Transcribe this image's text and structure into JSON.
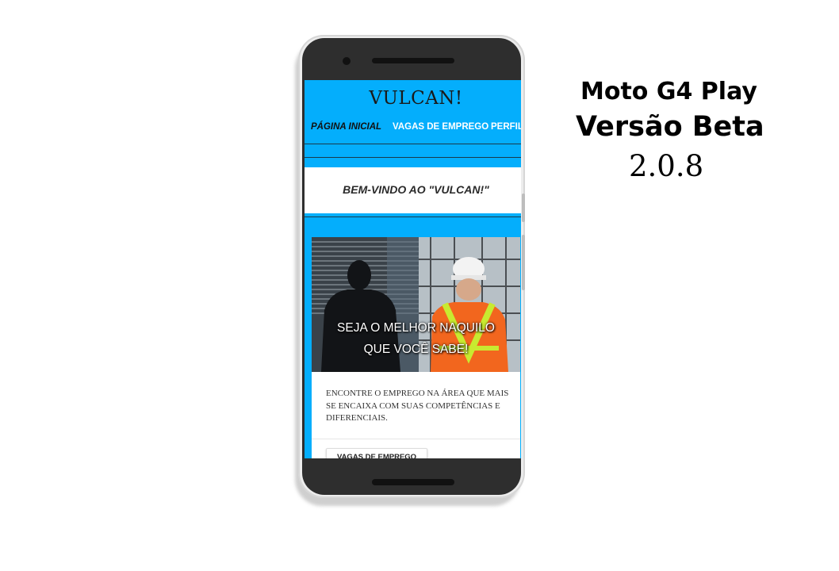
{
  "site": {
    "title": "VULCAN!",
    "nav": [
      {
        "label": "PÁGINA INICIAL"
      },
      {
        "label": "VAGAS DE EMPREGO"
      },
      {
        "label": "PERFIL"
      }
    ],
    "welcome": "BEM-VINDO AO \"VULCAN!\"",
    "hero": {
      "caption_line1": "SEJA O MELHOR NAQUILO",
      "caption_line2": "QUE VOCÊ SABE!"
    },
    "card_text": "ENCONTRE O EMPREGO NA ÁREA QUE MAIS SE ENCAIXA COM SUAS COMPETÊNCIAS E DIFERENCIAIS.",
    "button_label": "VAGAS DE EMPREGO"
  },
  "device_label": {
    "model": "Moto G4 Play",
    "version": "Versão Beta",
    "number": "2.0.8"
  },
  "colors": {
    "screen_bg": "#04aefc",
    "phone_body": "#2e2e2e",
    "vest": "#f2661e",
    "reflective": "#c8ea30"
  }
}
